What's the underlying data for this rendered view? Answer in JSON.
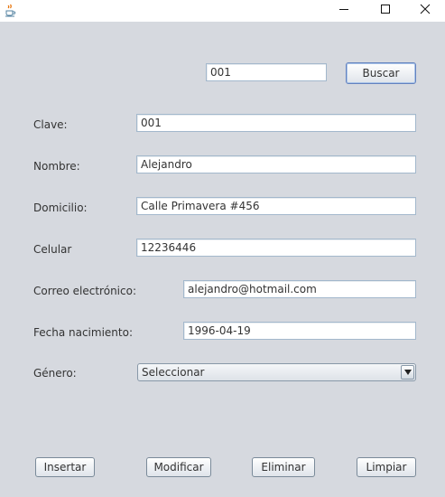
{
  "window": {
    "title": ""
  },
  "search": {
    "value": "001",
    "button_label": "Buscar"
  },
  "form": {
    "clave": {
      "label": "Clave:",
      "value": "001"
    },
    "nombre": {
      "label": "Nombre:",
      "value": "Alejandro"
    },
    "domicilio": {
      "label": "Domicilio:",
      "value": "Calle Primavera #456"
    },
    "celular": {
      "label": "Celular",
      "value": "12236446"
    },
    "correo": {
      "label": "Correo electrónico:",
      "value": "alejandro@hotmail.com"
    },
    "fecha": {
      "label": "Fecha nacimiento:",
      "value": "1996-04-19"
    },
    "genero": {
      "label": "Género:",
      "selected": "Seleccionar"
    }
  },
  "actions": {
    "insertar": "Insertar",
    "modificar": "Modificar",
    "eliminar": "Eliminar",
    "limpiar": "Limpiar"
  },
  "icons": {
    "app": "java-coffee-icon",
    "minimize": "minimize-icon",
    "maximize": "maximize-icon",
    "close": "close-icon",
    "dropdown": "chevron-down-icon"
  }
}
